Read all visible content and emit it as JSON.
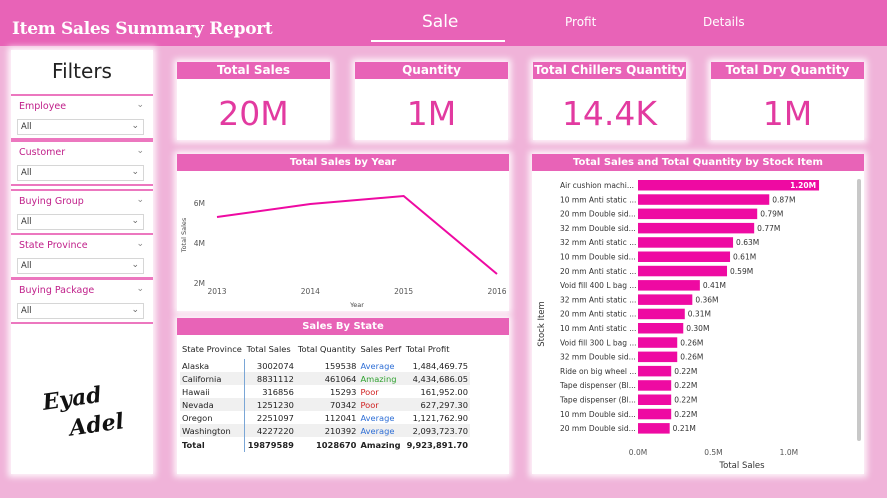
{
  "header": {
    "title": "Item Sales Summary Report",
    "tabs": [
      {
        "label": "Sale",
        "active": true
      },
      {
        "label": "Profit",
        "active": false
      },
      {
        "label": "Details",
        "active": false
      }
    ]
  },
  "filters": {
    "title": "Filters",
    "slicers": [
      {
        "label": "Employee",
        "value": "All"
      },
      {
        "label": "Customer",
        "value": "All"
      },
      {
        "label": "Buying Group",
        "value": "All"
      },
      {
        "label": "State Province",
        "value": "All"
      },
      {
        "label": "Buying Package",
        "value": "All"
      }
    ],
    "signature": "Eyad Adel"
  },
  "kpis": [
    {
      "label": "Total Sales",
      "value": "20M"
    },
    {
      "label": "Quantity",
      "value": "1M"
    },
    {
      "label": "Total Chillers Quantity",
      "value": "14.4K"
    },
    {
      "label": "Total Dry Quantity",
      "value": "1M"
    }
  ],
  "colors": {
    "accent": "#e863b7",
    "bar": "#ee0aa2",
    "value": "#e23aa0",
    "background": "#f0b3d9"
  },
  "chart_data": [
    {
      "type": "line",
      "title": "Total Sales by Year",
      "xlabel": "Year",
      "ylabel": "Total Sales",
      "x": [
        "2013",
        "2014",
        "2015",
        "2016"
      ],
      "series": [
        {
          "values": [
            5.3,
            5.95,
            6.35,
            2.45
          ]
        }
      ],
      "yticks": [
        "2M",
        "4M",
        "6M"
      ],
      "ylim": [
        2,
        6.8
      ]
    },
    {
      "type": "bar",
      "orientation": "horizontal",
      "title": "Total Sales and Total Quantity by Stock Item",
      "xlabel": "Total Sales",
      "ylabel": "Stock Item",
      "categories": [
        "Air cushion machi...",
        "10 mm Anti static ...",
        "20 mm Double sid...",
        "32 mm Double sid...",
        "32 mm Anti static ...",
        "10 mm Double sid...",
        "20 mm Anti static ...",
        "Void fill 400 L bag ...",
        "32 mm Anti static ...",
        "20 mm Anti static ...",
        "10 mm Anti static ...",
        "Void fill 300 L bag ...",
        "32 mm Double sid...",
        "Ride on big wheel ...",
        "Tape dispenser (Bl...",
        "Tape dispenser (Bl...",
        "10 mm Double sid...",
        "20 mm Double sid..."
      ],
      "values": [
        1.2,
        0.87,
        0.79,
        0.77,
        0.63,
        0.61,
        0.59,
        0.41,
        0.36,
        0.31,
        0.3,
        0.26,
        0.26,
        0.22,
        0.22,
        0.22,
        0.22,
        0.21
      ],
      "labels": [
        "1.20M",
        "0.87M",
        "0.79M",
        "0.77M",
        "0.63M",
        "0.61M",
        "0.59M",
        "0.41M",
        "0.36M",
        "0.31M",
        "0.30M",
        "0.26M",
        "0.26M",
        "0.22M",
        "0.22M",
        "0.22M",
        "0.22M",
        "0.21M"
      ],
      "xticks": [
        "0.0M",
        "0.5M",
        "1.0M"
      ],
      "xlim": [
        0,
        1.25
      ]
    }
  ],
  "state_table": {
    "title": "Sales By State",
    "columns": [
      "State Province",
      "Total Sales",
      "Total Quantity",
      "Sales Perf",
      "Total Profit"
    ],
    "rows": [
      [
        "Alaska",
        "3002074",
        "159538",
        "Average",
        "1,484,469.75"
      ],
      [
        "California",
        "8831112",
        "461064",
        "Amazing",
        "4,434,686.05"
      ],
      [
        "Hawaii",
        "316856",
        "15293",
        "Poor",
        "161,952.00"
      ],
      [
        "Nevada",
        "1251230",
        "70342",
        "Poor",
        "627,297.30"
      ],
      [
        "Oregon",
        "2251097",
        "112041",
        "Average",
        "1,121,762.90"
      ],
      [
        "Washington",
        "4227220",
        "210392",
        "Average",
        "2,093,723.70"
      ]
    ],
    "total": [
      "Total",
      "19879589",
      "1028670",
      "Amazing",
      "9,923,891.70"
    ]
  }
}
